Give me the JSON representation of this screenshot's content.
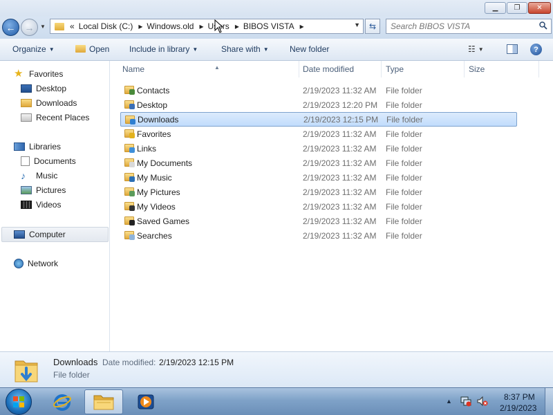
{
  "window": {
    "minimize_glyph": "▁",
    "maximize_glyph": "❐",
    "close_glyph": "✕"
  },
  "address": {
    "overflow": "«",
    "crumbs": [
      "Local Disk (C:)",
      "Windows.old",
      "Users",
      "BIBOS VISTA"
    ],
    "separator": "▸"
  },
  "search": {
    "placeholder": "Search BIBOS VISTA"
  },
  "toolbar": {
    "organize": "Organize",
    "open": "Open",
    "include": "Include in library",
    "share": "Share with",
    "new_folder": "New folder"
  },
  "nav": {
    "favorites": "Favorites",
    "desktop": "Desktop",
    "downloads": "Downloads",
    "recent": "Recent Places",
    "libraries": "Libraries",
    "documents": "Documents",
    "music": "Music",
    "pictures": "Pictures",
    "videos": "Videos",
    "computer": "Computer",
    "network": "Network"
  },
  "columns": {
    "name": "Name",
    "date": "Date modified",
    "type": "Type",
    "size": "Size"
  },
  "files": [
    {
      "name": "Contacts",
      "date": "2/19/2023 11:32 AM",
      "type": "File folder",
      "badge": "#4a8a3a"
    },
    {
      "name": "Desktop",
      "date": "2/19/2023 12:20 PM",
      "type": "File folder",
      "badge": "#3b6fb6"
    },
    {
      "name": "Downloads",
      "date": "2/19/2023 12:15 PM",
      "type": "File folder",
      "badge": "#2f7fd0"
    },
    {
      "name": "Favorites",
      "date": "2/19/2023 11:32 AM",
      "type": "File folder",
      "badge": "#e2b21d"
    },
    {
      "name": "Links",
      "date": "2/19/2023 11:32 AM",
      "type": "File folder",
      "badge": "#3f8fd8"
    },
    {
      "name": "My Documents",
      "date": "2/19/2023 11:32 AM",
      "type": "File folder",
      "badge": "#d9d9d9"
    },
    {
      "name": "My Music",
      "date": "2/19/2023 11:32 AM",
      "type": "File folder",
      "badge": "#2d6fb3"
    },
    {
      "name": "My Pictures",
      "date": "2/19/2023 11:32 AM",
      "type": "File folder",
      "badge": "#5b9b5b"
    },
    {
      "name": "My Videos",
      "date": "2/19/2023 11:32 AM",
      "type": "File folder",
      "badge": "#333333"
    },
    {
      "name": "Saved Games",
      "date": "2/19/2023 11:32 AM",
      "type": "File folder",
      "badge": "#222222"
    },
    {
      "name": "Searches",
      "date": "2/19/2023 11:32 AM",
      "type": "File folder",
      "badge": "#8fb3d9"
    }
  ],
  "selected_index": 2,
  "details": {
    "name": "Downloads",
    "date_label": "Date modified:",
    "date": "2/19/2023 12:15 PM",
    "type": "File folder"
  },
  "taskbar": {
    "time": "8:37 PM",
    "date": "2/19/2023",
    "apps": [
      "start-orb",
      "internet-explorer",
      "windows-explorer",
      "windows-media-player"
    ]
  },
  "colors": {
    "selection": "#cce4fc",
    "accent": "#1e3a5f",
    "taskbar": "#7fa2c8"
  }
}
